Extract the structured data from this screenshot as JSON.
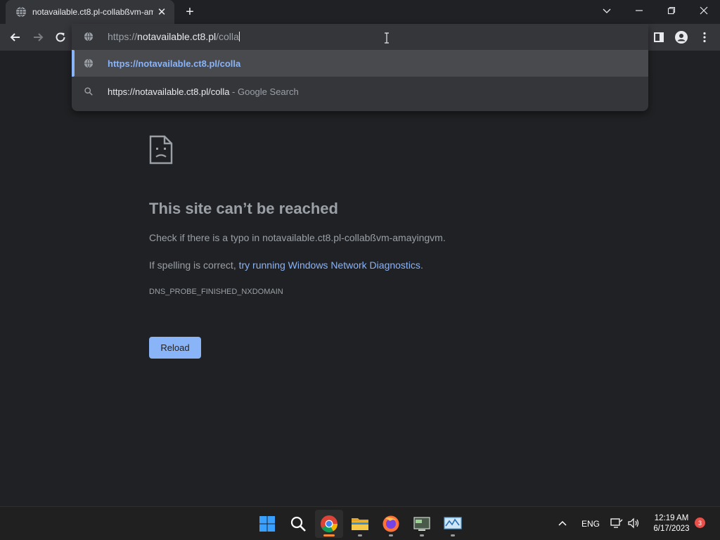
{
  "tab": {
    "title": "notavailable.ct8.pl-collabßvm-am"
  },
  "omnibox": {
    "input_prefix": "https://",
    "input_host": "notavailable.ct8.pl",
    "input_path": "/colla",
    "suggestions": [
      {
        "text": "https://notavailable.ct8.pl/colla",
        "suffix": "",
        "icon": "globe-icon"
      },
      {
        "text": "https://notavailable.ct8.pl/colla",
        "suffix": " - Google Search",
        "icon": "search-icon"
      }
    ]
  },
  "error": {
    "title": "This site can’t be reached",
    "typo_line": "Check if there is a typo in notavailable.ct8.pl-collabßvm-amayingvm.",
    "spelling_prefix": "If spelling is correct, ",
    "spelling_link": "try running Windows Network Diagnostics",
    "spelling_suffix": ".",
    "code": "DNS_PROBE_FINISHED_NXDOMAIN",
    "reload_label": "Reload"
  },
  "taskbar": {
    "language": "ENG",
    "time": "12:19 AM",
    "date": "6/17/2023",
    "notifications": "3"
  },
  "colors": {
    "accent": "#8ab4f8",
    "background": "#202124",
    "toolbar": "#35363a"
  }
}
